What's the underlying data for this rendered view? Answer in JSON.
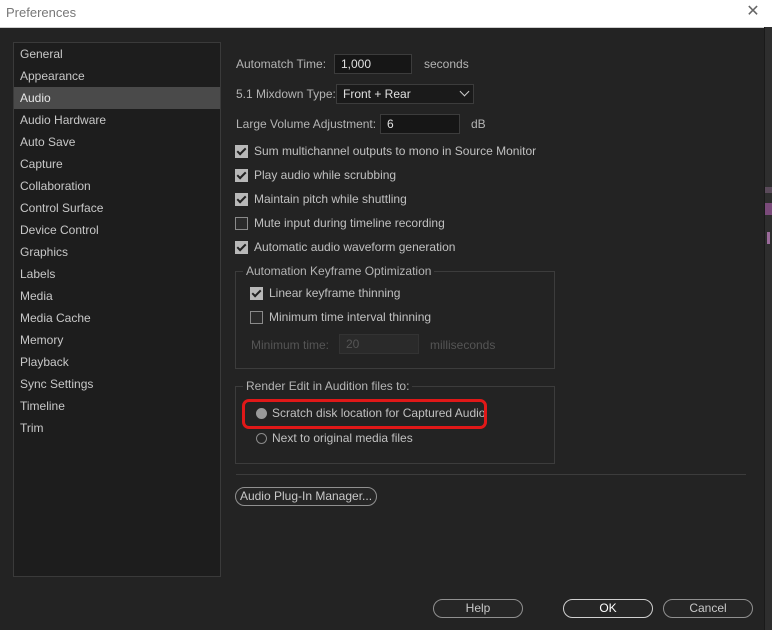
{
  "window": {
    "title": "Preferences",
    "close_glyph": "✕"
  },
  "sidebar": {
    "items": [
      {
        "label": "General"
      },
      {
        "label": "Appearance"
      },
      {
        "label": "Audio"
      },
      {
        "label": "Audio Hardware"
      },
      {
        "label": "Auto Save"
      },
      {
        "label": "Capture"
      },
      {
        "label": "Collaboration"
      },
      {
        "label": "Control Surface"
      },
      {
        "label": "Device Control"
      },
      {
        "label": "Graphics"
      },
      {
        "label": "Labels"
      },
      {
        "label": "Media"
      },
      {
        "label": "Media Cache"
      },
      {
        "label": "Memory"
      },
      {
        "label": "Playback"
      },
      {
        "label": "Sync Settings"
      },
      {
        "label": "Timeline"
      },
      {
        "label": "Trim"
      }
    ],
    "selected": "Audio"
  },
  "audio": {
    "automatch": {
      "label": "Automatch Time:",
      "value": "1,000",
      "unit": "seconds"
    },
    "mixdown": {
      "label": "5.1 Mixdown Type:",
      "value": "Front + Rear"
    },
    "large_volume": {
      "label": "Large Volume Adjustment:",
      "value": "6",
      "unit": "dB"
    },
    "checkboxes": [
      {
        "label": "Sum multichannel outputs to mono in Source Monitor",
        "checked": true
      },
      {
        "label": "Play audio while scrubbing",
        "checked": true
      },
      {
        "label": "Maintain pitch while shuttling",
        "checked": true
      },
      {
        "label": "Mute input during timeline recording",
        "checked": false
      },
      {
        "label": "Automatic audio waveform generation",
        "checked": true
      }
    ],
    "keyframe_group": {
      "title": "Automation Keyframe Optimization",
      "linear": {
        "label": "Linear keyframe thinning",
        "checked": true
      },
      "min_interval": {
        "label": "Minimum time interval thinning",
        "checked": false
      },
      "min_time": {
        "label": "Minimum time:",
        "value": "20",
        "unit": "milliseconds"
      }
    },
    "render_group": {
      "title": "Render Edit in Audition files to:",
      "options": [
        {
          "label": "Scratch disk location for Captured Audio",
          "selected": true
        },
        {
          "label": "Next to original media files",
          "selected": false
        }
      ]
    },
    "plugin_manager_label": "Audio Plug-In Manager..."
  },
  "footer": {
    "help": "Help",
    "ok": "OK",
    "cancel": "Cancel"
  }
}
